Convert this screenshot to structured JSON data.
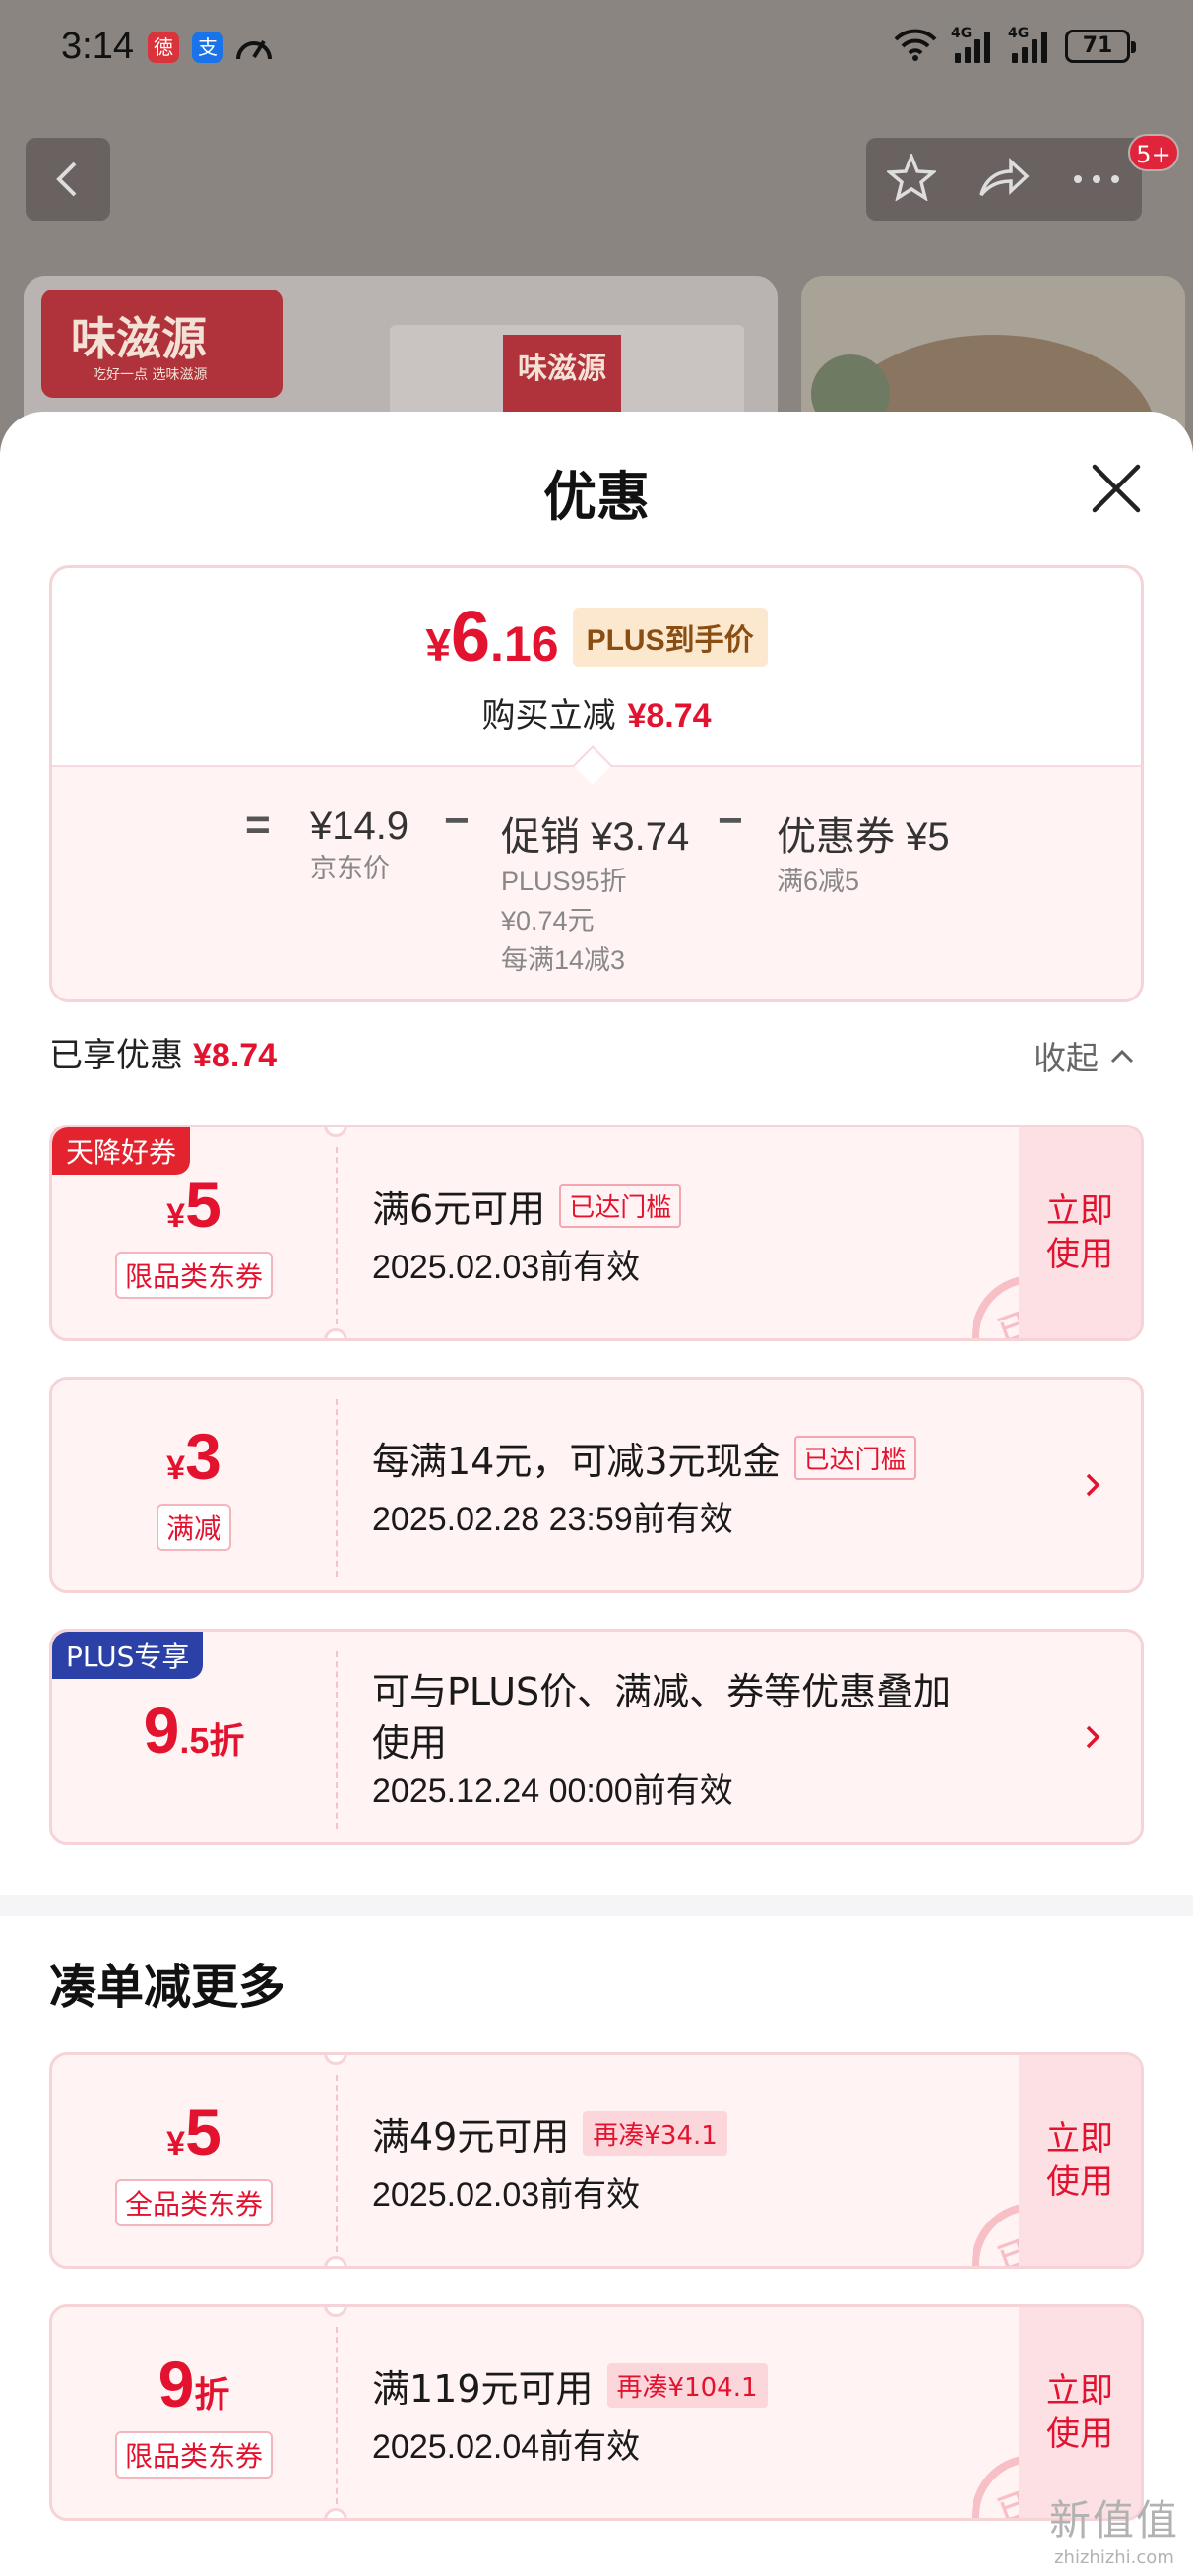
{
  "status_bar": {
    "time": "3:14",
    "app_icon_1": "徳",
    "app_icon_2": "支",
    "network_1": "4G",
    "network_2": "4G",
    "battery": "71"
  },
  "nav": {
    "back_icon": "chevron-left-icon",
    "favorite_icon": "star-icon",
    "share_icon": "share-icon",
    "more_icon": "more-dots-icon",
    "message_badge": "5+"
  },
  "product_images": {
    "brand_logo": "味滋源",
    "brand_sub": "吃好一点 选味滋源",
    "package_logo": "味滋源"
  },
  "sheet": {
    "title": "优惠",
    "close_icon": "close-icon"
  },
  "price_summary": {
    "currency": "¥",
    "final_int": "6",
    "final_dec": ".16",
    "plus_tag": "PLUS到手价",
    "reduce_label": "购买立减",
    "reduce_value": "¥8.74",
    "equals": "=",
    "minus": "−",
    "jd_price": "¥14.9",
    "jd_price_label": "京东价",
    "promo_label": "促销",
    "promo_value": "¥3.74",
    "promo_detail_1": "PLUS95折",
    "promo_detail_2": "¥0.74元",
    "promo_detail_3": "每满14减3",
    "coupon_label": "优惠券",
    "coupon_value": "¥5",
    "coupon_detail": "满6减5"
  },
  "savings": {
    "label": "已享优惠",
    "value": "¥8.74",
    "collapse_label": "收起"
  },
  "coupons": [
    {
      "corner": "天降好券",
      "currency": "¥",
      "amount": "5",
      "type": "限品类东券",
      "condition": "满6元可用",
      "status": "已达门槛",
      "validity": "2025.02.03前有效",
      "action": "立即使用",
      "stamp": "已领"
    },
    {
      "currency": "¥",
      "amount": "3",
      "type": "满减",
      "condition": "每满14元，可减3元现金",
      "status": "已达门槛",
      "validity": "2025.02.28 23:59前有效"
    },
    {
      "corner": "PLUS专享",
      "amount": "9",
      "suffix": ".5折",
      "condition_line1": "可与PLUS价、满减、券等优惠叠加",
      "condition_line2": "使用",
      "validity": "2025.12.24 00:00前有效"
    }
  ],
  "more_section": {
    "title": "凑单减更多",
    "coupons": [
      {
        "currency": "¥",
        "amount": "5",
        "type": "全品类东券",
        "condition": "满49元可用",
        "status": "再凑¥34.1",
        "validity": "2025.02.03前有效",
        "action": "立即使用",
        "stamp": "已领"
      },
      {
        "amount": "9",
        "suffix": "折",
        "type": "限品类东券",
        "condition": "满119元可用",
        "status": "再凑¥104.1",
        "validity": "2025.02.04前有效",
        "action": "立即使用",
        "stamp": "已领"
      }
    ]
  },
  "watermark": {
    "line1": "新值值",
    "line2": "zhizhizhi.com"
  },
  "colors": {
    "accent_red": "#e3132f",
    "coupon_bg": "#fff3f4",
    "plus_blue": "#2c41a7",
    "plus_gold": "#fbe8cf"
  }
}
